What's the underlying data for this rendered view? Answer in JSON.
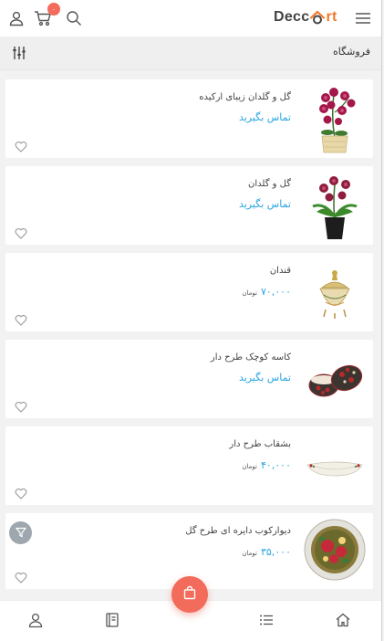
{
  "header": {
    "logo_text_start": "Decc",
    "logo_text_end": "rt",
    "cart_count": "۰",
    "icons": [
      "user-icon",
      "cart-icon",
      "search-icon",
      "menu-icon"
    ]
  },
  "subbar": {
    "title": "فروشگاه",
    "filter_icon": "sliders-icon"
  },
  "products": [
    {
      "title": "گل و گلدان زیبای ارکیده",
      "contact": "تماس بگیرید",
      "price": null,
      "currency": null,
      "image": "orchid-white-pot"
    },
    {
      "title": "گل و گلدان",
      "contact": "تماس بگیرید",
      "price": null,
      "currency": null,
      "image": "orchid-black-pot"
    },
    {
      "title": "قندان",
      "contact": null,
      "price": "۷۰,۰۰۰",
      "currency": "تومان",
      "image": "sugar-bowl"
    },
    {
      "title": "کاسه کوچک طرح دار",
      "contact": "تماس بگیرید",
      "price": null,
      "currency": null,
      "image": "patterned-bowl"
    },
    {
      "title": "بشقاب طرح دار",
      "contact": null,
      "price": "۴۰,۰۰۰",
      "currency": "تومان",
      "image": "patterned-plate"
    },
    {
      "title": "دیوارکوب دایره ای طرح گل",
      "contact": null,
      "price": "۳۵,۰۰۰",
      "currency": "تومان",
      "image": "floral-wall-plate"
    }
  ],
  "bottom_nav": [
    "user-icon",
    "book-icon",
    "cart-fab-icon",
    "list-icon",
    "home-icon"
  ],
  "colors": {
    "accent": "#f26b5b",
    "link": "#29a6e0",
    "logo": "#f07a2c"
  }
}
